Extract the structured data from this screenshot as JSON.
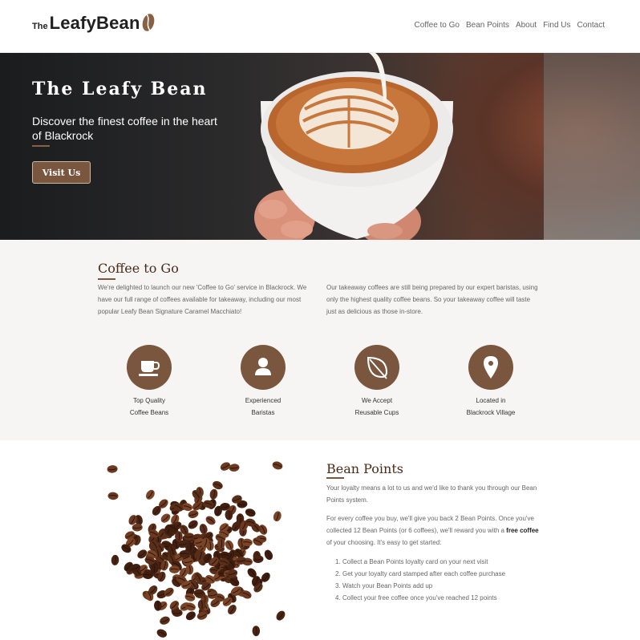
{
  "header": {
    "logo_the": "The",
    "logo_main": "LeafyBean",
    "nav": [
      "Coffee to Go",
      "Bean Points",
      "About",
      "Find Us",
      "Contact"
    ]
  },
  "hero": {
    "title": "The Leafy Bean",
    "subtitle": "Discover the finest coffee in the heart of Blackrock",
    "button": "Visit Us"
  },
  "togo": {
    "title": "Coffee to Go",
    "p1": "We're delighted to launch our new 'Coffee to Go' service in Blackrock. We have our full range of coffees available for takeaway, including our most popular Leafy Bean Signature Caramel Macchiato!",
    "p2": "Our takeaway coffees are still being prepared by our expert baristas, using only the highest quality coffee beans. So your takeaway coffee will taste just as delicious as those in-store.",
    "features": [
      {
        "icon": "coffee-cup-icon",
        "line1": "Top Quality",
        "line2": "Coffee Beans"
      },
      {
        "icon": "person-icon",
        "line1": "Experienced",
        "line2": "Baristas"
      },
      {
        "icon": "leaf-icon",
        "line1": "We Accept",
        "line2": "Reusable Cups"
      },
      {
        "icon": "map-pin-icon",
        "line1": "Located in",
        "line2": "Blackrock Village"
      }
    ]
  },
  "bean_points": {
    "title": "Bean Points",
    "p1": "Your loyalty means a lot to us and we'd like to thank you through our Bean Points system.",
    "p2_start": "For every coffee you buy, we'll give you back 2 Bean Points. Once you've collected 12 Bean Points (or 6 coffees), we'll reward you with a ",
    "p2_bold": "free coffee",
    "p2_end": " of your choosing. It's easy to get started:",
    "steps": [
      "Collect a Bean Points loyalty card on your next visit",
      "Get your loyalty card stamped after each coffee purchase",
      "Watch your Bean Points add up",
      "Collect your free coffee once you've reached 12 points"
    ]
  },
  "colors": {
    "brand_brown": "#7a563e",
    "heading_brown": "#4a2b1b",
    "section_bg": "#f7f5f3"
  }
}
